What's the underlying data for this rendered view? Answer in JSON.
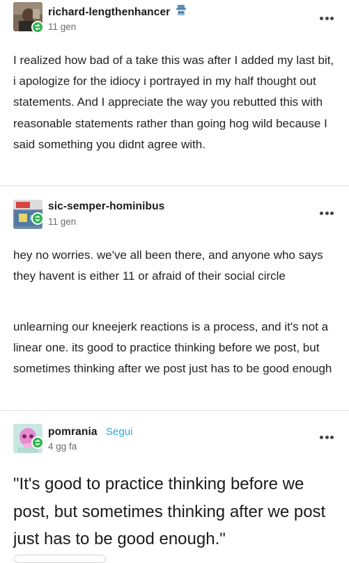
{
  "posts": [
    {
      "username": "richard-lengthenhancer",
      "time": "11 gen",
      "badge_icon": "robot-hat-icon",
      "paragraphs": [
        "I realized how bad of a take this was after I added my last bit, i apologize for the idiocy i portrayed in my half thought out statements. And I appreciate the way you rebutted this with reasonable statements rather than going hog wild because I said something you didnt agree with."
      ]
    },
    {
      "username": "sic-semper-hominibus",
      "time": "11 gen",
      "paragraphs": [
        "hey no worries. we've all been there, and anyone who says they havent is either 11 or afraid of their social circle",
        "unlearning our kneejerk reactions is a process, and it's not a linear one. its good to practice thinking before we post, but sometimes thinking after we post just has to be good enough"
      ]
    },
    {
      "username": "pomrania",
      "follow_label": "Segui",
      "time": "4 gg fa",
      "quote": "\"It's good to practice thinking before we post, but sometimes thinking after we post just has to be good enough.\""
    }
  ],
  "colors": {
    "reblog_badge": "#2bb34b",
    "follow_link": "#2fa8d8",
    "separator": "#ececec"
  }
}
